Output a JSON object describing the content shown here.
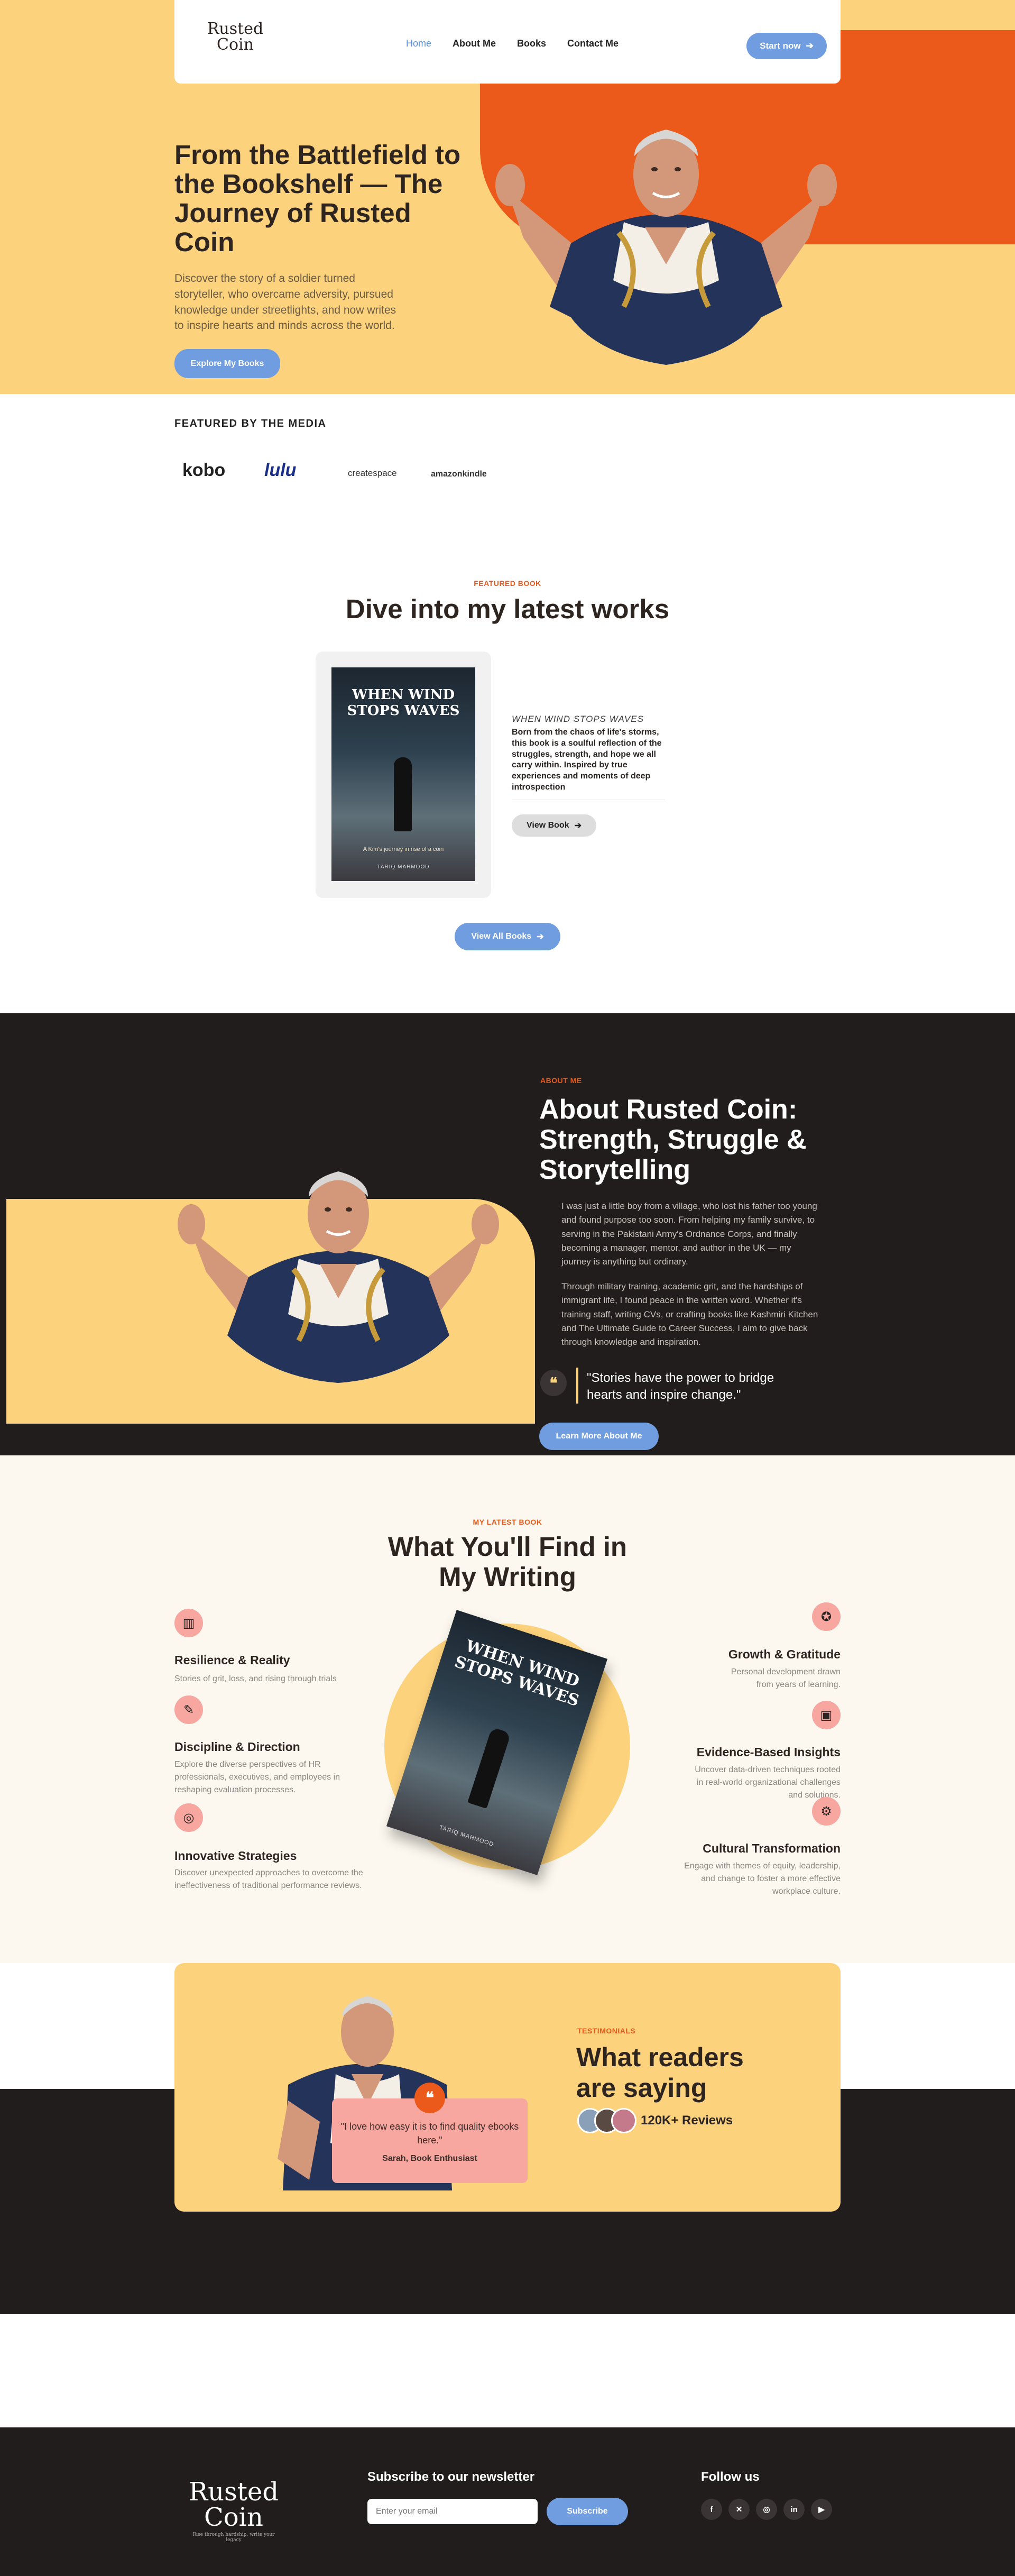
{
  "brand": {
    "name_line1": "Rusted",
    "name_line2": "Coin",
    "tagline": "Rise through hardship, write your legacy"
  },
  "nav": {
    "items": [
      "Home",
      "About Me",
      "Books",
      "Contact Me"
    ],
    "cta": "Start now"
  },
  "hero": {
    "title": "From the Battlefield to the Bookshelf — The Journey of Rusted Coin",
    "description": "Discover the story of a soldier turned storyteller, who overcame adversity, pursued knowledge under streetlights, and now writes to inspire hearts and minds across the world.",
    "button": "Explore My Books"
  },
  "media": {
    "title": "FEATURED BY THE MEDIA",
    "logos": [
      "kobo",
      "lulu",
      "createspace",
      "amazonkindle"
    ]
  },
  "featured": {
    "kicker": "FEATURED BOOK",
    "title": "Dive into my latest works",
    "book": {
      "cover_title": "WHEN WIND STOPS WAVES",
      "cover_tagline": "A Kim's journey in rise of a coin",
      "cover_author": "TARIQ MAHMOOD",
      "subtitle": "WHEN WIND STOPS WAVES",
      "description": "Born from the chaos of life's storms, this book is a soulful reflection of the struggles, strength, and hope we all carry within. Inspired by true experiences and moments of deep introspection",
      "button": "View Book"
    },
    "view_all": "View All Books"
  },
  "about": {
    "kicker": "ABOUT ME",
    "title": "About Rusted Coin: Strength, Struggle & Storytelling",
    "p1": "I was just a little boy from a village, who lost his father too young and found purpose too soon. From helping my family survive, to serving in the Pakistani Army's Ordnance Corps, and finally becoming a manager, mentor, and author in the UK — my journey is anything but ordinary.",
    "p2": "Through military training, academic grit, and the hardships of immigrant life, I found peace in the written word. Whether it's training staff, writing CVs, or crafting books like Kashmiri Kitchen and The Ultimate Guide to Career Success, I aim to give back through knowledge and inspiration.",
    "quote": "\"Stories have the power to bridge hearts and inspire change.\"",
    "button": "Learn More About Me"
  },
  "writing": {
    "kicker": "MY LATEST BOOK",
    "title": "What You'll Find in My Writing",
    "left": [
      {
        "title": "Resilience & Reality",
        "desc": "Stories of grit, loss, and rising through trials",
        "icon": "map-icon"
      },
      {
        "title": "Discipline & Direction",
        "desc": "Explore the diverse perspectives of HR professionals, executives, and employees in reshaping evaluation processes.",
        "icon": "pen-icon"
      },
      {
        "title": "Innovative Strategies",
        "desc": "Discover unexpected approaches to overcome the ineffectiveness of traditional performance reviews.",
        "icon": "target-icon"
      }
    ],
    "right": [
      {
        "title": "Growth & Gratitude",
        "desc": "Personal development drawn from years of learning.",
        "icon": "award-icon"
      },
      {
        "title": "Evidence-Based Insights",
        "desc": "Uncover data-driven techniques rooted in real-world organizational challenges and solutions.",
        "icon": "book-icon"
      },
      {
        "title": "Cultural Transformation",
        "desc": "Engage with themes of equity, leadership, and change to foster a more effective workplace culture.",
        "icon": "gear-icon"
      }
    ]
  },
  "testimonials": {
    "kicker": "TESTIMONIALS",
    "title": "What readers are saying",
    "quote": "\"I love how easy it is to find quality ebooks here.\"",
    "author": "Sarah, Book Enthusiast",
    "reviews": "120K+ Reviews"
  },
  "footer": {
    "newsletter_title": "Subscribe to our newsletter",
    "email_placeholder": "Enter your email",
    "subscribe": "Subscribe",
    "follow": "Follow us",
    "socials": [
      "facebook-icon",
      "x-icon",
      "instagram-icon",
      "linkedin-icon",
      "youtube-icon"
    ]
  },
  "colors": {
    "yellow": "#fdd27c",
    "orange": "#eb5a1a",
    "dark": "#221d1d",
    "blue": "#6f9de0",
    "pink": "#f8a6a0"
  }
}
